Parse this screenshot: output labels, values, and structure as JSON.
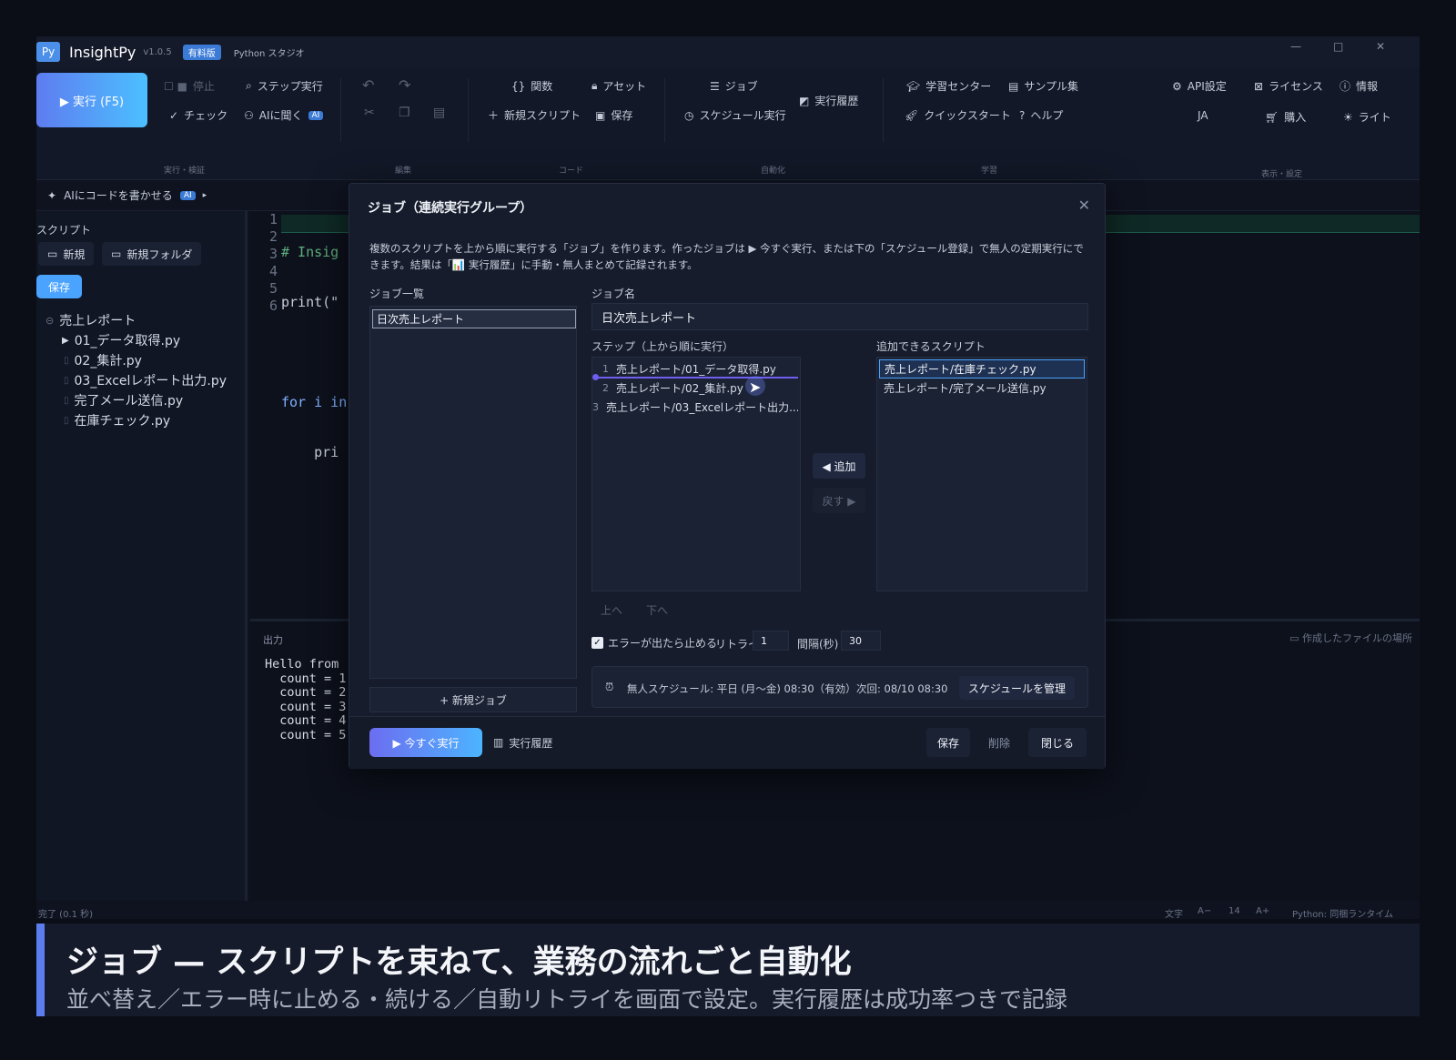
{
  "app": {
    "logo_text": "Py",
    "name": "InsightPy",
    "version": "v1.0.5",
    "edition_badge": "有料版",
    "subtitle": "Python スタジオ",
    "window_controls": {
      "minimize": "—",
      "maximize": "□",
      "close": "✕"
    }
  },
  "ribbon": {
    "run_label": "▶ 実行 (F5)",
    "stop_label": "停止",
    "step_run_label": "ステップ実行",
    "check_label": "チェック",
    "ask_ai_label": "AIに聞く",
    "ai_badge": "AI",
    "group_run": "実行・検証",
    "group_edit": "編集",
    "functions_label": "関数",
    "assets_label": "アセット",
    "new_script_label": "新規スクリプト",
    "save_label": "保存",
    "group_code": "コード",
    "jobs_label": "ジョブ",
    "schedule_run_label": "スケジュール実行",
    "history_label": "実行履歴",
    "group_automation": "自動化",
    "learning_center_label": "学習センター",
    "samples_label": "サンプル集",
    "quickstart_label": "クイックスタート",
    "help_label": "ヘルプ",
    "group_learning": "学習",
    "api_settings_label": "API設定",
    "license_label": "ライセンス",
    "info_label": "情報",
    "language_label": "JA",
    "purchase_label": "購入",
    "theme_label": "ライト",
    "group_display": "表示・設定"
  },
  "ai_bar": {
    "label": "AIにコードを書かせる",
    "badge": "AI",
    "arrow": "▸"
  },
  "sidebar": {
    "title": "スクリプト",
    "new_label": "新規",
    "new_folder_label": "新規フォルダ",
    "save_label": "保存",
    "folder": "売上レポート",
    "files": [
      "01_データ取得.py",
      "02_集計.py",
      "03_Excelレポート出力.py",
      "完了メール送信.py",
      "在庫チェック.py"
    ]
  },
  "editor": {
    "line_numbers": [
      "1",
      "2",
      "3",
      "4",
      "5",
      "6"
    ],
    "lines": [
      "# Insig",
      "print(\"",
      "",
      "for i in",
      "    pri",
      ""
    ]
  },
  "output": {
    "title": "出力",
    "open_location": "作成したファイルの場所",
    "text": "Hello from\n  count = 1\n  count = 2\n  count = 3\n  count = 4\n  count = 5"
  },
  "status": {
    "left": "完了 (0.1 秒)",
    "text_size_label": "文字",
    "font_dec": "A−",
    "font_size": "14",
    "font_inc": "A+",
    "runtime": "Python: 同梱ランタイム"
  },
  "dialog": {
    "title": "ジョブ（連続実行グループ）",
    "close": "✕",
    "description": "複数のスクリプトを上から順に実行する「ジョブ」を作ります。作ったジョブは ▶ 今すぐ実行、または下の「スケジュール登録」で無人の定期実行にできます。結果は「📊 実行履歴」に手動・無人まとめて記録されます。",
    "job_list_label": "ジョブ一覧",
    "jobs": [
      "日次売上レポート"
    ],
    "new_job_label": "+ 新規ジョブ",
    "job_name_label": "ジョブ名",
    "job_name_value": "日次売上レポート",
    "steps_label": "ステップ（上から順に実行）",
    "steps": [
      {
        "num": "1",
        "name": "売上レポート/01_データ取得.py"
      },
      {
        "num": "2",
        "name": "売上レポート/02_集計.py"
      },
      {
        "num": "3",
        "name": "売上レポート/03_Excelレポート出力...."
      }
    ],
    "available_label": "追加できるスクリプト",
    "available": [
      "売上レポート/在庫チェック.py",
      "売上レポート/完了メール送信.py"
    ],
    "add_label": "◀ 追加",
    "back_label": "戻す ▶",
    "up_label": "上へ",
    "down_label": "下へ",
    "stop_on_error_label": "エラーが出たら止める",
    "retry_label": "リトライ",
    "retry_value": "1",
    "interval_label": "間隔(秒)",
    "interval_value": "30",
    "schedule_text": "無人スケジュール: 平日 (月〜金) 08:30（有効）",
    "next_run": "次回: 08/10 08:30",
    "manage_schedule_label": "スケジュールを管理",
    "run_now_label": "▶ 今すぐ実行",
    "history_label": "実行履歴",
    "save_label": "保存",
    "delete_label": "削除",
    "close_label": "閉じる"
  },
  "banner": {
    "title": "ジョブ — スクリプトを束ねて、業務の流れごと自動化",
    "subtitle": "並べ替え／エラー時に止める・続ける／自動リトライを画面で設定。実行履歴は成功率つきで記録"
  },
  "colors": {
    "accent": "#4aa3ff",
    "run_gradient_start": "#5e7cf0",
    "run_gradient_end": "#4cc0ff",
    "banner_bar": "#5b7df0"
  }
}
